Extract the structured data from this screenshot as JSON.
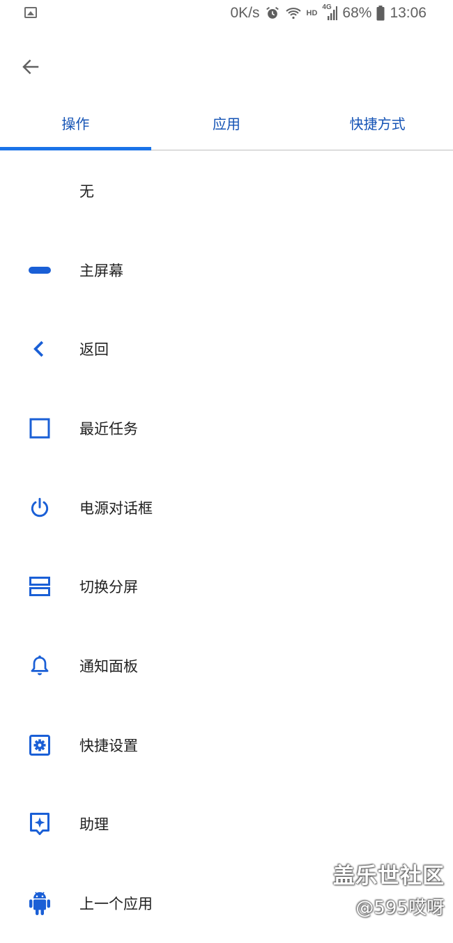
{
  "status_bar": {
    "net_speed": "0K/s",
    "hd_label": "HD",
    "network_type": "4G",
    "battery": "68%",
    "time": "13:06"
  },
  "tabs": [
    {
      "label": "操作",
      "active": true
    },
    {
      "label": "应用",
      "active": false
    },
    {
      "label": "快捷方式",
      "active": false
    }
  ],
  "actions": [
    {
      "label": "无",
      "icon": "none"
    },
    {
      "label": "主屏幕",
      "icon": "home-pill-icon"
    },
    {
      "label": "返回",
      "icon": "back-chevron-icon"
    },
    {
      "label": "最近任务",
      "icon": "recents-square-icon"
    },
    {
      "label": "电源对话框",
      "icon": "power-icon"
    },
    {
      "label": "切换分屏",
      "icon": "split-screen-icon"
    },
    {
      "label": "通知面板",
      "icon": "bell-icon"
    },
    {
      "label": "快捷设置",
      "icon": "settings-gear-icon"
    },
    {
      "label": "助理",
      "icon": "assistant-icon"
    },
    {
      "label": "上一个应用",
      "icon": "android-icon"
    }
  ],
  "watermark": {
    "line1": "盖乐世社区",
    "line2": "@595哎呀"
  },
  "colors": {
    "accent": "#1a73e8",
    "icon_blue": "#1a5fd6",
    "tab_text": "#1453b5"
  }
}
